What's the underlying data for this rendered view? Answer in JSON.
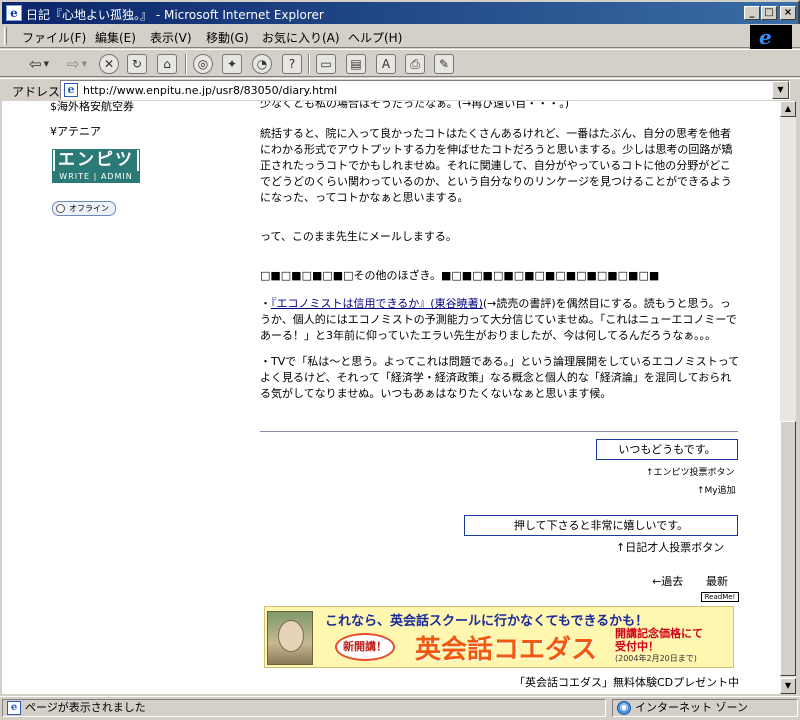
{
  "window": {
    "title": "日記『心地よい孤独。』 - Microsoft Internet Explorer",
    "minimize": "_",
    "maximize": "□",
    "close": "×"
  },
  "menu": {
    "items": [
      "ファイル(F)",
      "編集(E)",
      "表示(V)",
      "移動(G)",
      "お気に入り(A)",
      "ヘルプ(H)"
    ]
  },
  "toolbar": {
    "back_glyph": "⇦",
    "forward_glyph": "⇨",
    "dropdown_glyph": "▼",
    "icons": [
      "✕",
      "↻",
      "⌂",
      "◎",
      "✦",
      "◔",
      "?",
      "▭",
      "▤",
      "A",
      "⎙",
      "✎"
    ]
  },
  "address": {
    "label": "アドレス",
    "url": "http://www.enpitu.ne.jp/usr8/83050/diary.html"
  },
  "sidebar": {
    "link_partial": "$海外格安航空券",
    "link_atenia": "¥アテニア",
    "logo_top": "エンピツ",
    "logo_bottom": "WRITE | ADMIN",
    "offline": "オフライン"
  },
  "article": {
    "p0": "少なくとも私の場合はそうだったなぁ。(→再び遠い目・・・。)",
    "p1": "統括すると、院に入って良かったコトはたくさんあるけれど、一番はたぶん、自分の思考を他者にわかる形式でアウトプットする力を伸ばせたコトだろうと思いまする。少しは思考の回路が矯正されたっうコトでかもしれませぬ。それに関連して、自分がやっているコトに他の分野がどこでどうどのくらい関わっているのか、という自分なりのリンケージを見つけることができるようになった、ってコトかなぁと思いまする。",
    "p2": "って、このまま先生にメールしまする。",
    "heading": "□■□■□■□■□その他のほざき。■□■□■□■□■□■□■□■□■□■□■",
    "p3_pre": "・",
    "p3_link1": "『エコノミストは信用できるか』",
    "p3_link2": "(東谷暁著)",
    "p3_post": "(→読売の書評)を偶然目にする。読もうと思う。っうか、個人的にはエコノミストの予測能力って大分信じていませぬ。「これはニューエコノミーであーる！」と3年前に仰っていたエラい先生がおりましたが、今は何してるんだろうなぁ。。。",
    "p4": "・TVで「私は〜と思う。よってこれは問題である。」という論理展開をしているエコノミストってよく見るけど、それって「経済学・経済政策」なる概念と個人的な「経済論」を混同しておられる気がしてなりませぬ。いつもあぁはなりたくないなぁと思います候。"
  },
  "vote": {
    "button1": "いつもどうもです。",
    "caption1": "↑エンピツ投票ボタン",
    "my_add": "↑My追加",
    "button2": "押して下さると非常に嬉しいです。",
    "caption2": "↑日記才人投票ボタン"
  },
  "nav": {
    "prev": "←過去",
    "latest": "最新",
    "readme": "ReadMe!"
  },
  "banner": {
    "tagline": "これなら、英会話スクールに行かなくてもできるかも！",
    "badge": "新開講！",
    "product": "英会話コエダス",
    "promo_line1": "開講記念価格にて",
    "promo_line2": "受付中！",
    "promo_date": "(2004年2月20日まで)"
  },
  "footer": {
    "caption": "「英会話コエダス」無料体験CDプレゼント中"
  },
  "status": {
    "left": "ページが表示されました",
    "right": "インターネット ゾーン"
  },
  "scroll": {
    "up": "▲",
    "down": "▼"
  }
}
